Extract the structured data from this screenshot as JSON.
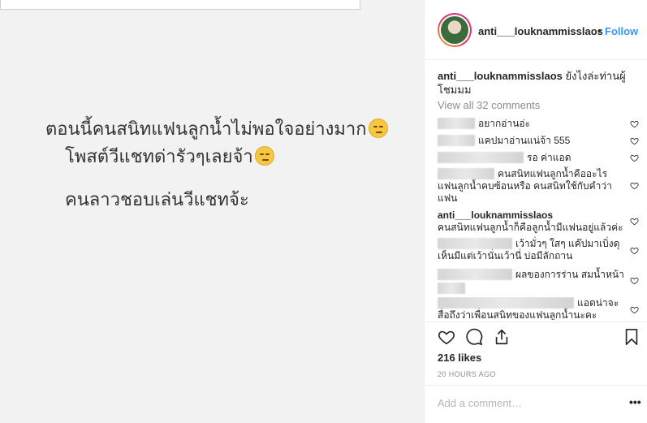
{
  "post_image": {
    "line1": "ตอนนี้คนสนิทแฟนลูกน้ำไม่พอใจอย่างมาก",
    "line2": "โพสต์วีแชทด่ารัวๆเลยจ้า",
    "line3": "คนลาวชอบเล่นวีแชทจ้ะ"
  },
  "header": {
    "username": "anti___louknammisslaos",
    "dot": "•",
    "follow_label": "Follow"
  },
  "caption": {
    "username": "anti___louknammisslaos",
    "text": "ยังไงล่ะท่านผู้โชมมม"
  },
  "view_all_comments": "View all 32 comments",
  "comments": [
    {
      "text": "อยากอ่านอ่ะ"
    },
    {
      "text": "แคปมาอ่านแน่จ้า 555"
    },
    {
      "text": "รอ ค่าแอด"
    },
    {
      "text": "คนสนิทแฟนลูกน้ำคืออะไร แฟนลูกน้ำคบซ้อนหรือ คนสนิทใช้กับคำว่าแฟน"
    },
    {
      "username": "anti___louknammisslaos",
      "text": "คนสนิทแฟนลูกน้ำก็คือลูกน้ำมีแฟนอยู่แล้วค่ะ"
    },
    {
      "text": "เว้ามั่วๆ ใสๆ แค๊ปมาเบิ่งดุ เห็นมีแต่เว้านั่นเว้านี่ บ่อมีลักถาน"
    },
    {
      "text": "ผลของการร่าน สมน้ำหน้า"
    },
    {
      "text": "แอดน่าจะสื่อถึงว่าเพื่อนสนิทของแฟนลูกน้ำนะคะ"
    }
  ],
  "likes": "216 likes",
  "timestamp": "20 HOURS AGO",
  "add_comment_placeholder": "Add a comment…",
  "more_label": "•••",
  "colors": {
    "link_blue": "#3897f0",
    "muted": "#8e8e8e",
    "text": "#262626"
  }
}
